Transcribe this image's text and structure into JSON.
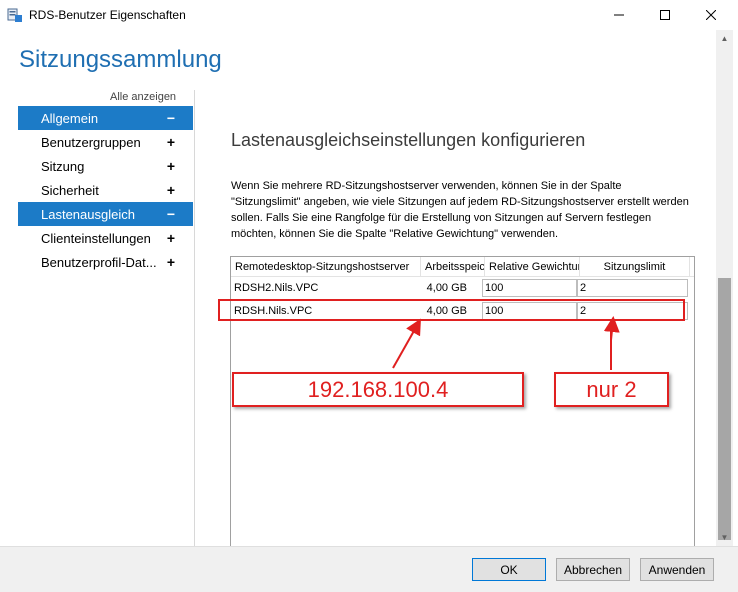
{
  "window": {
    "title": "RDS-Benutzer Eigenschaften",
    "icons": {
      "app": "server-properties-icon",
      "minimize": "minimize-icon",
      "maximize": "maximize-icon",
      "close": "close-icon"
    }
  },
  "page": {
    "heading": "Sitzungssammlung",
    "show_all": "Alle anzeigen"
  },
  "nav": {
    "items": [
      {
        "label": "Allgemein",
        "sign": "−",
        "active": true
      },
      {
        "label": "Benutzergruppen",
        "sign": "+",
        "active": false
      },
      {
        "label": "Sitzung",
        "sign": "+",
        "active": false
      },
      {
        "label": "Sicherheit",
        "sign": "+",
        "active": false
      },
      {
        "label": "Lastenausgleich",
        "sign": "−",
        "active": true
      },
      {
        "label": "Clienteinstellungen",
        "sign": "+",
        "active": false
      },
      {
        "label": "Benutzerprofil-Dat...",
        "sign": "+",
        "active": false
      }
    ]
  },
  "section": {
    "title": "Lastenausgleichseinstellungen konfigurieren",
    "description": "Wenn Sie mehrere RD-Sitzungshostserver verwenden, können Sie in der Spalte \"Sitzungslimit\" angeben, wie viele Sitzungen auf jedem RD-Sitzungshostserver erstellt werden sollen. Falls Sie eine Rangfolge für die Erstellung von Sitzungen auf Servern festlegen möchten, können Sie die Spalte \"Relative Gewichtung\" verwenden."
  },
  "table": {
    "columns": [
      "Remotedesktop-Sitzungshostserver",
      "Arbeitsspeicher",
      "Relative Gewichtung",
      "Sitzungslimit"
    ],
    "rows": [
      {
        "server": "RDSH2.Nils.VPC",
        "memory": "4,00 GB",
        "weight": "100",
        "limit": "2"
      },
      {
        "server": "RDSH.Nils.VPC",
        "memory": "4,00 GB",
        "weight": "100",
        "limit": "2"
      }
    ]
  },
  "annotations": {
    "ip_label": "192.168.100.4",
    "limit_label": "nur 2",
    "color": "#e02020"
  },
  "buttons": {
    "ok": "OK",
    "cancel": "Abbrechen",
    "apply": "Anwenden"
  },
  "colors": {
    "accent": "#1c7bc7",
    "heading": "#1f6fb2"
  }
}
